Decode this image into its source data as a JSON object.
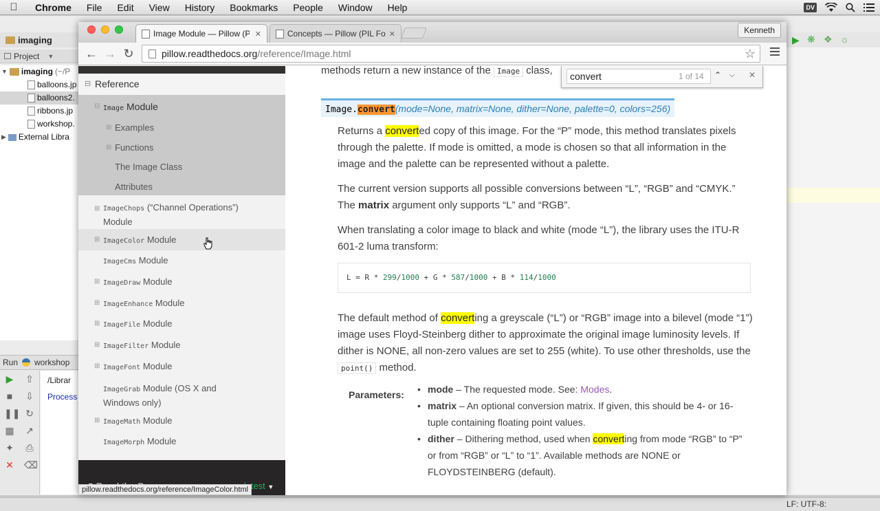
{
  "menubar": {
    "app_name": "Chrome",
    "items": [
      "File",
      "Edit",
      "View",
      "History",
      "Bookmarks",
      "People",
      "Window",
      "Help"
    ],
    "status_badge": "DV"
  },
  "ide": {
    "project_tab": "imaging",
    "project_panel_label": "Project",
    "tree": [
      {
        "label": "imaging",
        "suffix": "(~/P"
      },
      {
        "label": "balloons.jp"
      },
      {
        "label": "balloons2."
      },
      {
        "label": "ribbons.jp"
      },
      {
        "label": "workshop."
      },
      {
        "label": "External Libra"
      }
    ],
    "run_label": "Run",
    "run_config": "workshop",
    "console_lines": [
      "/Librar",
      "Process"
    ],
    "status_right": "LF: UTF-8:"
  },
  "browser": {
    "tabs": [
      {
        "title": "Image Module — Pillow (P",
        "active": true
      },
      {
        "title": "Concepts — Pillow (PIL Fo",
        "active": false
      }
    ],
    "user_name": "Kenneth",
    "url_host": "pillow.readthedocs.org",
    "url_path": "/reference/Image.html",
    "status_url": "pillow.readthedocs.org/reference/ImageColor.html"
  },
  "find": {
    "query": "convert",
    "count": "1 of 14"
  },
  "sidebar": {
    "section_title": "Reference",
    "current": {
      "code": "Image",
      "label": "Module"
    },
    "sub_items": [
      "Examples",
      "Functions",
      "The Image Class",
      "Attributes"
    ],
    "modules": [
      {
        "code": "ImageChops",
        "label": "(“Channel Operations”)",
        "label2": "Module"
      },
      {
        "code": "ImageColor",
        "label": "Module"
      },
      {
        "code": "ImageCms",
        "label": "Module"
      },
      {
        "code": "ImageDraw",
        "label": "Module"
      },
      {
        "code": "ImageEnhance",
        "label": "Module"
      },
      {
        "code": "ImageFile",
        "label": "Module"
      },
      {
        "code": "ImageFilter",
        "label": "Module"
      },
      {
        "code": "ImageFont",
        "label": "Module"
      },
      {
        "code": "ImageGrab",
        "label": "Module (OS X and",
        "label2": "Windows only)"
      },
      {
        "code": "ImageMath",
        "label": "Module"
      },
      {
        "code": "ImageMorph",
        "label": "Module"
      }
    ],
    "footer_label": "Read the Docs",
    "footer_version": "v: latest"
  },
  "doc": {
    "intro_line": "methods return a new instance of the",
    "intro_code": "Image",
    "intro_end": "class,",
    "sig_class": "Image",
    "sig_dot": ".",
    "sig_func": "convert",
    "sig_params": "(mode=None, matrix=None, dither=None, palette=0, colors=256)",
    "p1_a": "Returns a ",
    "p1_hl": "convert",
    "p1_b": "ed copy of this image. For the “P” mode, this method translates pixels through the palette. If mode is omitted, a mode is chosen so that all information in the image and the palette can be represented without a palette.",
    "p2_a": "The current version supports all possible conversions between “L”, “RGB” and “CMYK.” The ",
    "p2_bold": "matrix",
    "p2_b": " argument only supports “L” and “RGB”.",
    "p3": "When translating a color image to black and white (mode “L”), the library uses the ITU-R 601-2 luma transform:",
    "code": {
      "c1": "L = R * ",
      "n1": "299",
      "c2": "/",
      "n2": "1000",
      "c3": " + G * ",
      "n3": "587",
      "c4": "/",
      "n4": "1000",
      "c5": " + B * ",
      "n5": "114",
      "c6": "/",
      "n6": "1000"
    },
    "p4_a": "The default method of ",
    "p4_hl": "convert",
    "p4_b": "ing a greyscale (“L”) or “RGB” image into a bilevel (mode “1”) image uses Floyd-Steinberg dither to approximate the original image luminosity levels. If dither is NONE, all non-zero values are set to 255 (white). To use other thresholds, use the ",
    "p4_code": "point()",
    "p4_c": " method.",
    "params_label": "Parameters:",
    "param_mode_name": "mode",
    "param_mode_text": " – The requested mode. See: ",
    "param_mode_link": "Modes",
    "param_mode_end": ".",
    "param_matrix_name": "matrix",
    "param_matrix_text": " – An optional conversion matrix. If given, this should be 4- or 16-tuple containing floating point values.",
    "param_dither_name": "dither",
    "param_dither_a": " – Dithering method, used when ",
    "param_dither_hl": "convert",
    "param_dither_b": "ing from mode “RGB” to “P” or from “RGB” or “L” to “1”. Available methods are NONE or FLOYDSTEINBERG (default)."
  }
}
